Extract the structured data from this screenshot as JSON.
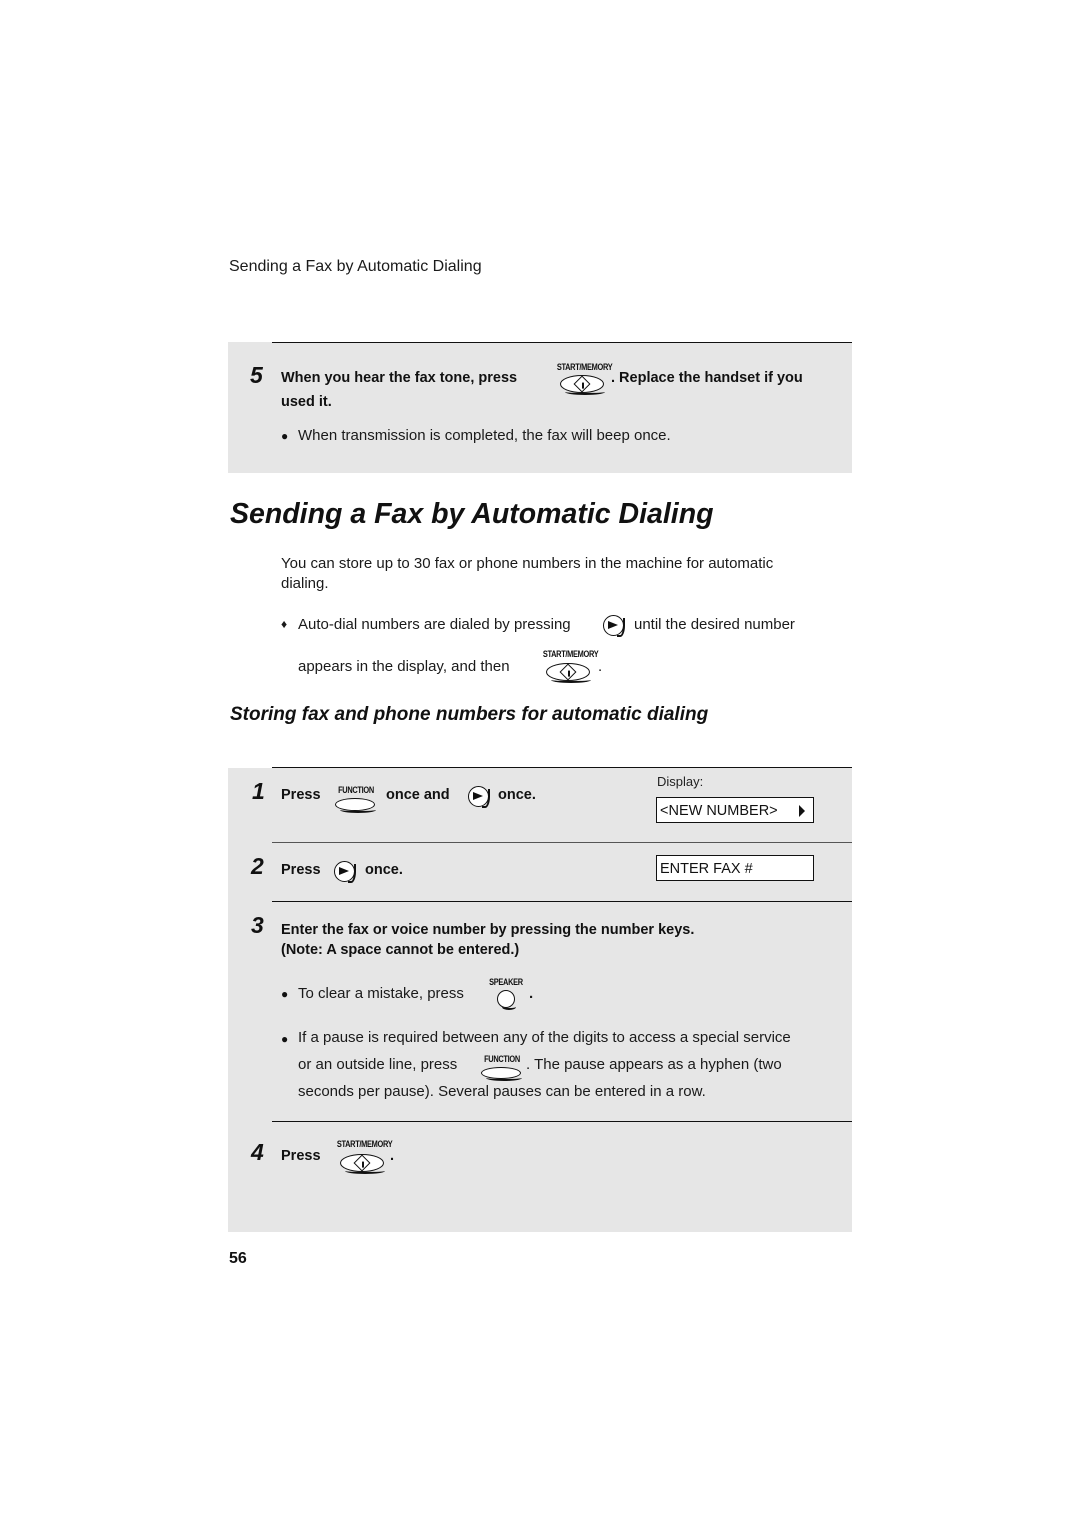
{
  "running_header": "Sending a Fax by Automatic Dialing",
  "top_box": {
    "step5": {
      "number": "5",
      "text_before": "When you hear the fax tone, press",
      "key": "START/MEMORY",
      "text_after": ". Replace the handset if you",
      "text_line2": "used it.",
      "bullet": "When transmission is completed, the fax will beep once."
    }
  },
  "section": {
    "title": "Sending a Fax by Automatic Dialing",
    "intro_line1": "You can store up to 30 fax or phone numbers in the machine for automatic",
    "intro_line2": "dialing.",
    "tip_line1_before": "Auto-dial numbers are dialed by pressing",
    "tip_line1_after": "until the desired number",
    "tip_line2_before": "appears in the display, and then",
    "tip_line2_after": ".",
    "tip_key": "START/MEMORY",
    "tip_bullet": "♦"
  },
  "subsection": {
    "title": "Storing fax and phone numbers for automatic dialing",
    "display_label": "Display:",
    "steps": [
      {
        "number": "1",
        "press": "Press",
        "key": "FUNCTION",
        "middle": "once and",
        "end": "once.",
        "display": "<NEW NUMBER>"
      },
      {
        "number": "2",
        "press": "Press",
        "end": "once.",
        "display": "ENTER FAX #"
      },
      {
        "number": "3",
        "line1": "Enter the fax or voice number by pressing the number keys.",
        "line2": "(Note: A space cannot be entered.)",
        "bullet1_before": "To clear a mistake, press",
        "bullet1_key": "SPEAKER",
        "bullet1_after": ".",
        "bullet2_line1": "If a pause is required between any of the digits to access a special service",
        "bullet2_line2_before": "or an outside line, press",
        "bullet2_key": "FUNCTION",
        "bullet2_line2_after": ". The pause appears as a hyphen (two",
        "bullet2_line3": "seconds per pause). Several pauses can be entered in a row."
      },
      {
        "number": "4",
        "press": "Press",
        "key": "START/MEMORY",
        "end": "."
      }
    ]
  },
  "page_number": "56"
}
